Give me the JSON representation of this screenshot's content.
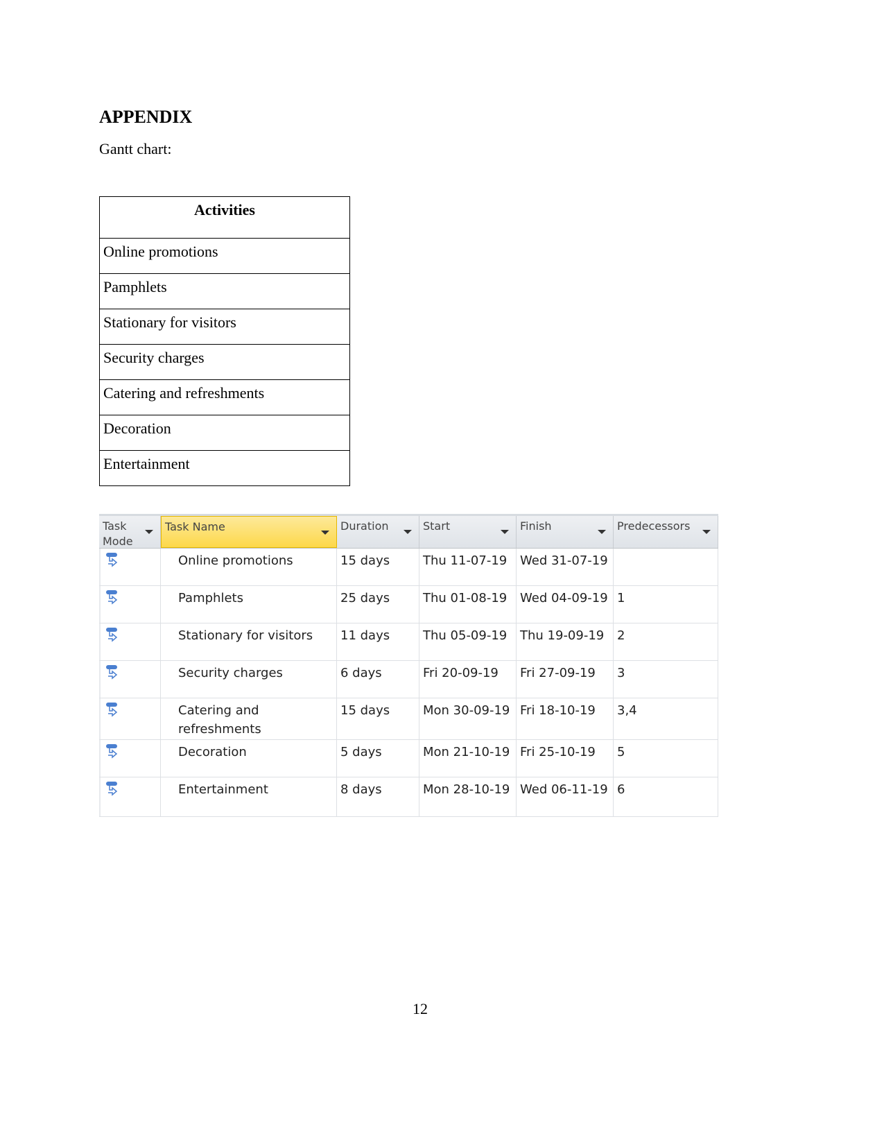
{
  "heading": "APPENDIX",
  "subheading": "Gantt chart:",
  "activities_table": {
    "header": "Activities",
    "rows": [
      "Online promotions",
      "Pamphlets",
      "Stationary for visitors",
      "Security charges",
      "Catering and refreshments",
      "Decoration",
      "Entertainment"
    ]
  },
  "project_table": {
    "columns": [
      "Task Mode",
      "Task Name",
      "Duration",
      "Start",
      "Finish",
      "Predecessors"
    ],
    "task_mode_icon": "auto-scheduled-task-icon",
    "rows": [
      {
        "name": "Online promotions",
        "duration": "15 days",
        "start": "Thu 11-07-19",
        "finish": "Wed 31-07-19",
        "pred": ""
      },
      {
        "name": "Pamphlets",
        "duration": "25 days",
        "start": "Thu 01-08-19",
        "finish": "Wed 04-09-19",
        "pred": "1"
      },
      {
        "name": "Stationary for visitors",
        "duration": "11 days",
        "start": "Thu 05-09-19",
        "finish": "Thu 19-09-19",
        "pred": "2"
      },
      {
        "name": "Security charges",
        "duration": "6 days",
        "start": "Fri 20-09-19",
        "finish": "Fri 27-09-19",
        "pred": "3"
      },
      {
        "name": "Catering and refreshments",
        "duration": "15 days",
        "start": "Mon 30-09-19",
        "finish": "Fri 18-10-19",
        "pred": "3,4"
      },
      {
        "name": "Decoration",
        "duration": "5 days",
        "start": "Mon 21-10-19",
        "finish": "Fri 25-10-19",
        "pred": "5"
      },
      {
        "name": "Entertainment",
        "duration": "8 days",
        "start": "Mon 28-10-19",
        "finish": "Wed 06-11-19",
        "pred": "6"
      }
    ]
  },
  "page_number": "12"
}
